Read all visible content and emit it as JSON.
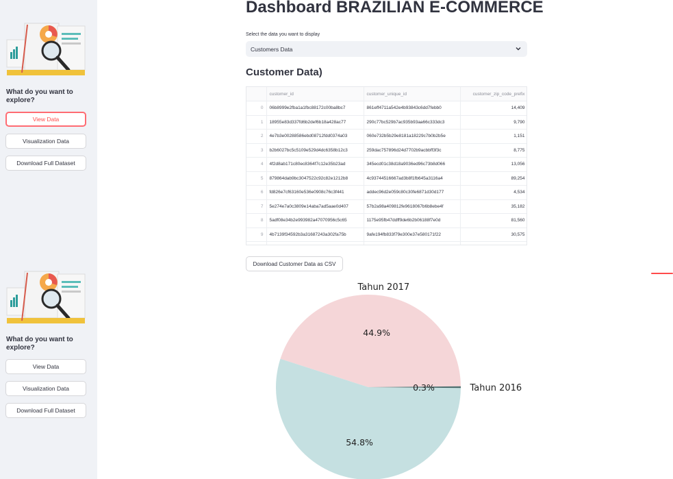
{
  "sidebar": {
    "groups": [
      {
        "question": "What do you want to explore?",
        "buttons": [
          {
            "label": "View Data",
            "active": true
          },
          {
            "label": "Visualization Data",
            "active": false
          },
          {
            "label": "Download Full Dataset",
            "active": false
          }
        ]
      },
      {
        "question": "What do you want to explore?",
        "buttons": [
          {
            "label": "View Data",
            "active": false
          },
          {
            "label": "Visualization Data",
            "active": false
          },
          {
            "label": "Download Full Dataset",
            "active": false
          }
        ]
      }
    ]
  },
  "main": {
    "title": "Dashboard BRAZILIAN E-COMMERCE",
    "select_label": "Select the data you want to display",
    "select_value": "Customers Data",
    "section_title": "Customer Data)",
    "table": {
      "columns": [
        "",
        "customer_id",
        "customer_unique_id",
        "customer_zip_code_prefix"
      ],
      "rows": [
        [
          "0",
          "06b8999e2fba1a1fbc88172c00ba8bc7",
          "861eff4711a542e4b93843c6dd7febb0",
          "14,409"
        ],
        [
          "1",
          "18955e83d337fd6b2def6b18a428ac77",
          "290c77bc529b7ac935b93aa66c333dc3",
          "9,790"
        ],
        [
          "2",
          "4e7b3e00288586ebd08712fdd0374a03",
          "060e732b5b29e8181a18229c7b0b2b5e",
          "1,151"
        ],
        [
          "3",
          "b2b6027bc5c5109e529d4dc6358b12c3",
          "259dac757896d24d7702b9acbbff3f3c",
          "8,775"
        ],
        [
          "4",
          "4f2d8ab171c80ec8364f7c12e35b23ad",
          "345ecd01c38d18a9036ed96c73b8d066",
          "13,056"
        ],
        [
          "5",
          "879864dab9bc3047522c92c82e1212b8",
          "4c93744516667ad3b8f1fb645a3116a4",
          "89,254"
        ],
        [
          "6",
          "fd826e7cf63160e536e0908c76c3f441",
          "addec96d2e059c80c30fe6871d30d177",
          "4,534"
        ],
        [
          "7",
          "5e274e7a0c3809e14aba7ad5aae0d407",
          "57b2a98a409812fe9618067b6b8ebe4f",
          "35,182"
        ],
        [
          "8",
          "5adf08e34b2e993982a47070956c5c65",
          "1175e95fb47ddff9de6b2b06188f7e0d",
          "81,560"
        ],
        [
          "9",
          "4b7139f34592b3a31687243a302fa75b",
          "9afe194fb833f79e300e37e580171f22",
          "30,575"
        ]
      ]
    },
    "csv_button": "Download Customer Data as CSV"
  },
  "chart_data": {
    "type": "pie",
    "title": "",
    "labels": [
      "Tahun 2017",
      "Tahun 2016",
      ""
    ],
    "values": [
      44.9,
      0.3,
      54.8
    ],
    "percent_labels": [
      "44.9%",
      "0.3%",
      "54.8%"
    ],
    "colors": [
      "#f5d6d8",
      "#4f6f6f",
      "#c5e0e1"
    ]
  },
  "colors": {
    "accent": "#ff4b4b",
    "sidebar_bg": "#f0f2f6",
    "text": "#31333f"
  }
}
